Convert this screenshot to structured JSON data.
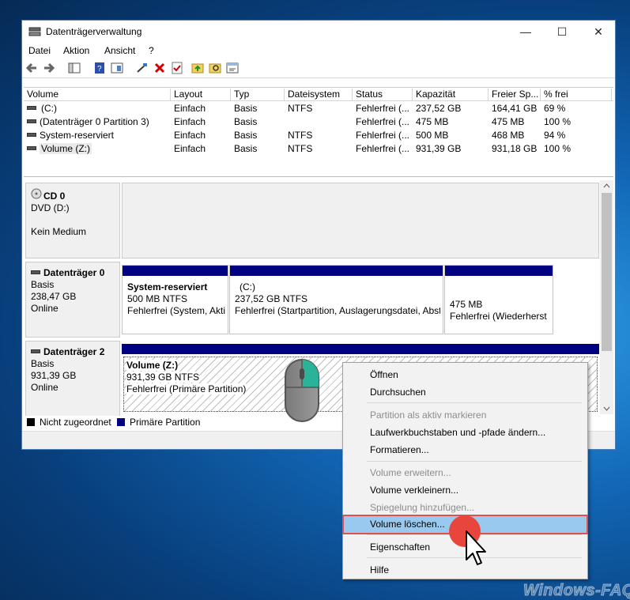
{
  "window": {
    "title": "Datenträgerverwaltung",
    "controls": {
      "minimize": "—",
      "maximize": "☐",
      "close": "✕"
    }
  },
  "menu": [
    "Datei",
    "Aktion",
    "Ansicht",
    "?"
  ],
  "volume_table": {
    "columns": [
      "Volume",
      "Layout",
      "Typ",
      "Dateisystem",
      "Status",
      "Kapazität",
      "Freier Sp...",
      "% frei"
    ],
    "rows": [
      [
        "(C:)",
        "Einfach",
        "Basis",
        "NTFS",
        "Fehlerfrei (...",
        "237,52 GB",
        "164,41 GB",
        "69 %"
      ],
      [
        "(Datenträger 0 Partition 3)",
        "Einfach",
        "Basis",
        "",
        "Fehlerfrei (...",
        "475 MB",
        "475 MB",
        "100 %"
      ],
      [
        "System-reserviert",
        "Einfach",
        "Basis",
        "NTFS",
        "Fehlerfrei (...",
        "500 MB",
        "468 MB",
        "94 %"
      ],
      [
        "Volume (Z:)",
        "Einfach",
        "Basis",
        "NTFS",
        "Fehlerfrei (...",
        "931,39 GB",
        "931,18 GB",
        "100 %"
      ]
    ]
  },
  "disks": {
    "cd0": {
      "name": "CD 0",
      "type": "DVD (D:)",
      "status": "Kein Medium"
    },
    "disk0": {
      "name": "Datenträger 0",
      "type": "Basis",
      "size": "238,47 GB",
      "state": "Online",
      "partitions": [
        {
          "name": "System-reserviert",
          "size": "500 MB NTFS",
          "status": "Fehlerfrei (System, Akti"
        },
        {
          "name": "(C:)",
          "size": "237,52 GB NTFS",
          "status": "Fehlerfrei (Startpartition, Auslagerungsdatei, Abst"
        },
        {
          "name": "",
          "size": "475 MB",
          "status": "Fehlerfrei (Wiederherst"
        }
      ]
    },
    "disk2": {
      "name": "Datenträger 2",
      "type": "Basis",
      "size": "931,39 GB",
      "state": "Online",
      "partition": {
        "name": "Volume  (Z:)",
        "size": "931,39 GB NTFS",
        "status": "Fehlerfrei (Primäre Partition)"
      }
    }
  },
  "legend": {
    "unallocated": "Nicht zugeordnet",
    "primary": "Primäre Partition"
  },
  "context_menu": {
    "items": [
      {
        "label": "Öffnen",
        "enabled": true
      },
      {
        "label": "Durchsuchen",
        "enabled": true
      },
      {
        "label": "Partition als aktiv markieren",
        "enabled": false
      },
      {
        "label": "Laufwerkbuchstaben und -pfade ändern...",
        "enabled": true
      },
      {
        "label": "Formatieren...",
        "enabled": true
      },
      {
        "label": "Volume erweitern...",
        "enabled": false
      },
      {
        "label": "Volume verkleinern...",
        "enabled": true
      },
      {
        "label": "Spiegelung hinzufügen...",
        "enabled": false
      },
      {
        "label": "Volume löschen...",
        "enabled": true,
        "highlighted": true
      },
      {
        "label": "Eigenschaften",
        "enabled": true
      },
      {
        "label": "Hilfe",
        "enabled": true
      }
    ]
  },
  "watermark": "Windows-FAQ",
  "colors": {
    "primary_partition": "#000080",
    "highlight": "#99c9ef",
    "highlight_border": "#e05050",
    "mouse_accent": "#2bb39a",
    "click_dot": "#e8453c"
  }
}
